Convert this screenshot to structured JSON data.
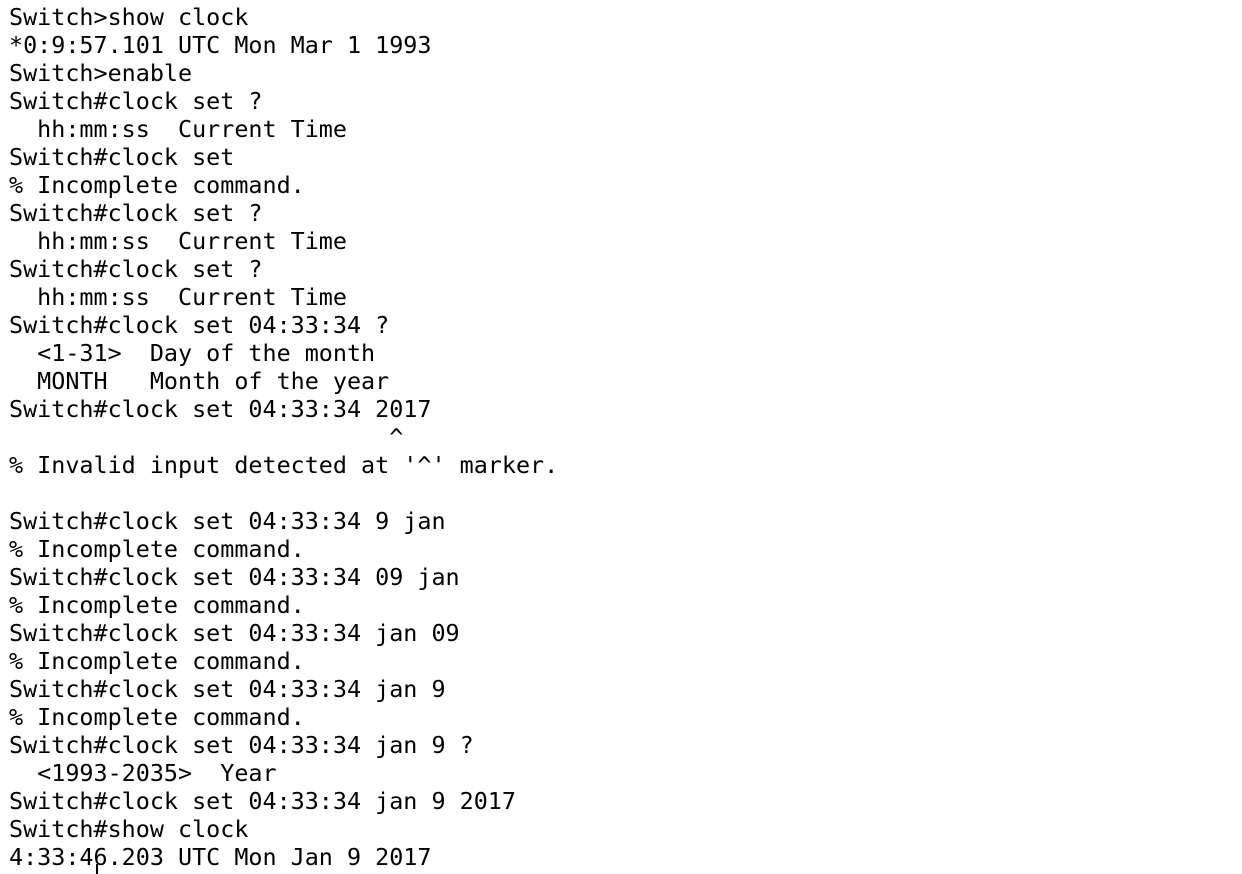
{
  "terminal": {
    "lines": [
      "Switch>show clock",
      "*0:9:57.101 UTC Mon Mar 1 1993",
      "Switch>enable",
      "Switch#clock set ?",
      "  hh:mm:ss  Current Time",
      "Switch#clock set",
      "% Incomplete command.",
      "Switch#clock set ?",
      "  hh:mm:ss  Current Time",
      "Switch#clock set ?",
      "  hh:mm:ss  Current Time",
      "Switch#clock set 04:33:34 ?",
      "  <1-31>  Day of the month",
      "  MONTH   Month of the year",
      "Switch#clock set 04:33:34 2017",
      "                           ^",
      "% Invalid input detected at '^' marker.",
      "",
      "Switch#clock set 04:33:34 9 jan",
      "% Incomplete command.",
      "Switch#clock set 04:33:34 09 jan",
      "% Incomplete command.",
      "Switch#clock set 04:33:34 jan 09",
      "% Incomplete command.",
      "Switch#clock set 04:33:34 jan 9",
      "% Incomplete command.",
      "Switch#clock set 04:33:34 jan 9 ?",
      "  <1993-2035>  Year",
      "Switch#clock set 04:33:34 jan 9 2017",
      "Switch#show clock",
      "4:33:46.203 UTC Mon Jan 9 2017"
    ]
  }
}
